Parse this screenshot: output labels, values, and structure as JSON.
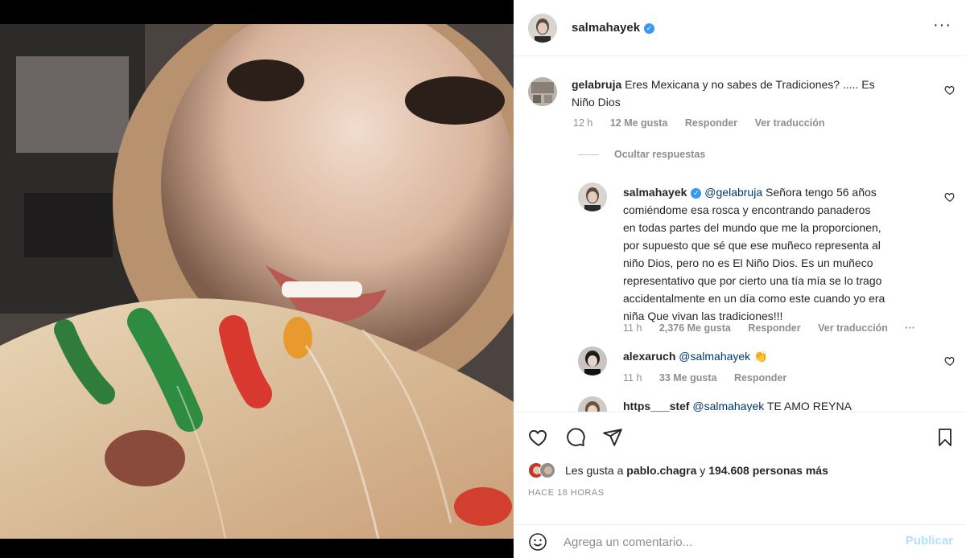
{
  "post": {
    "author": "salmahayek",
    "more_icon": "more-horizontal-icon"
  },
  "comments": [
    {
      "user": "gelabruja",
      "text_line1": "Eres Mexicana y no sabes de Tradiciones? ..... Es",
      "text_line2": "Niño Dios",
      "time": "12 h",
      "likes": "12 Me gusta",
      "reply": "Responder",
      "translate": "Ver traducción"
    }
  ],
  "hide_replies": "Ocultar respuestas",
  "replies": [
    {
      "user": "salmahayek",
      "mention": "@gelabruja",
      "lines": [
        "Señora tengo 56 años",
        "comiéndome esa rosca y encontrando panaderos",
        "en todas partes del mundo que me la proporcionen,",
        "por supuesto que sé que ese muñeco representa al",
        "niño Dios, pero no es El Niño Dios. Es un muñeco",
        "representativo que por cierto una tía mía se lo trago",
        "accidentalmente en un día como este cuando yo era",
        "niña Que vivan las tradiciones!!!"
      ],
      "time": "11 h",
      "likes": "2,376 Me gusta",
      "reply": "Responder",
      "translate": "Ver traducción",
      "more": "···"
    },
    {
      "user": "alexaruch",
      "mention": "@salmahayek",
      "emoji": "👏",
      "time": "11 h",
      "likes": "33 Me gusta",
      "reply": "Responder"
    },
    {
      "user": "https___stef",
      "mention": "@salmahayek",
      "text": "TE AMO REYNA"
    }
  ],
  "likes": {
    "prefix": "Les gusta a ",
    "user": "pablo.chagra",
    "middle": " y ",
    "count": "194.608 personas más"
  },
  "timestamp": "HACE 18 HORAS",
  "add_comment": {
    "placeholder": "Agrega un comentario...",
    "publish": "Publicar"
  },
  "colors": {
    "link_blue": "#3897f0",
    "publish_disabled": "#b2dffc",
    "meta_gray": "#8e8e8e"
  }
}
